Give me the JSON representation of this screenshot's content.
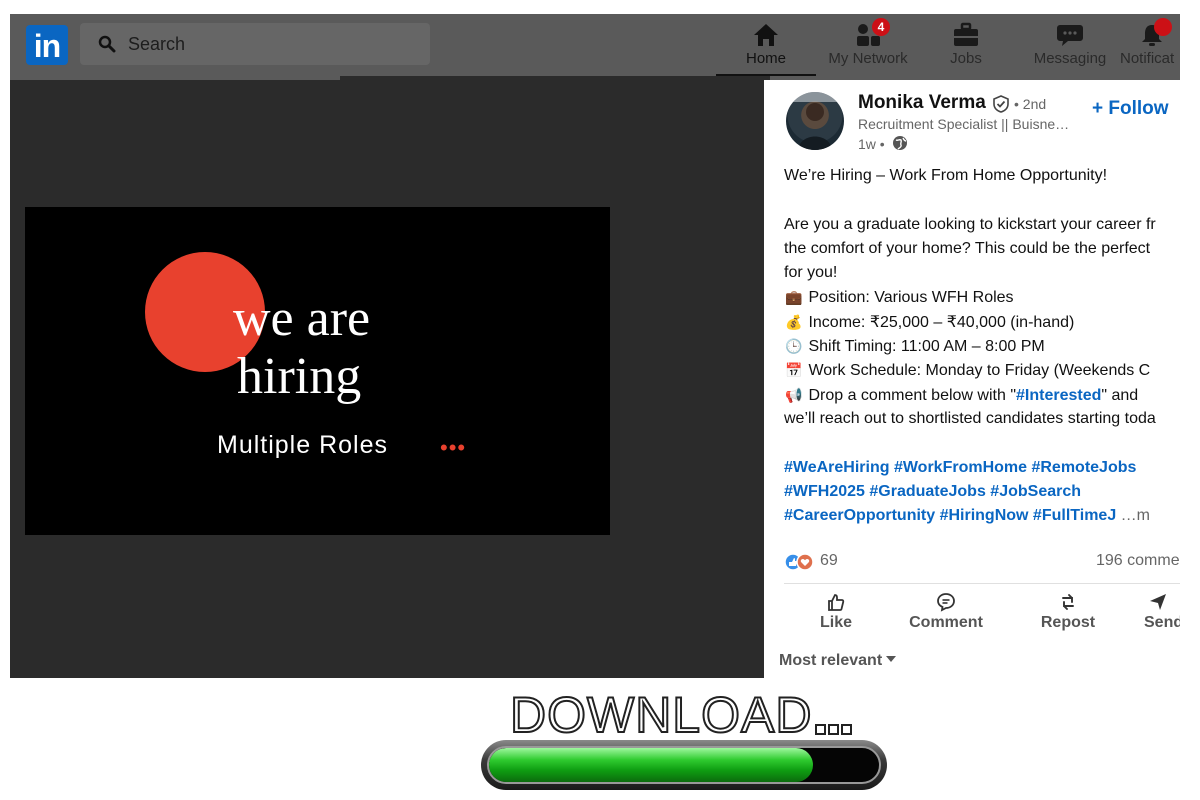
{
  "app": {
    "logo_text": "in",
    "brand_color": "#0a66c2"
  },
  "search": {
    "placeholder": "Search"
  },
  "nav": {
    "items": [
      {
        "label": "Home",
        "icon": "home-icon",
        "active": true
      },
      {
        "label": "My Network",
        "icon": "network-icon",
        "badge": "4"
      },
      {
        "label": "Jobs",
        "icon": "briefcase-icon"
      },
      {
        "label": "Messaging",
        "icon": "messaging-icon"
      },
      {
        "label": "Notificat",
        "icon": "bell-icon",
        "badge": ""
      }
    ]
  },
  "video": {
    "line1": "we are",
    "line2": "hiring",
    "line3": "Multiple Roles",
    "dots": "•••",
    "circle_color": "#e8412e"
  },
  "post": {
    "author": "Monika Verma",
    "degree": "• 2nd",
    "headline": "Recruitment Specialist || Buisne…",
    "time": "1w •",
    "follow": "+ Follow",
    "body": {
      "l1": "We’re Hiring – Work From Home Opportunity!",
      "l2": "Are you a graduate looking to kickstart your career fr",
      "l3": "the comfort of your home? This could be the perfect",
      "l4": "for you!",
      "l5": "Position: Various WFH Roles",
      "l6": "Income: ₹25,000 – ₹40,000 (in-hand)",
      "l7": "Shift Timing: 11:00 AM – 8:00 PM",
      "l8": "Work Schedule: Monday to Friday (Weekends C",
      "l9a": "Drop a comment below with \"",
      "l9tag": "#Interested",
      "l9b": "\" and",
      "l10": "we’ll reach out to shortlisted candidates starting toda"
    },
    "emoji": {
      "position": "💼",
      "income": "💰",
      "shift": "🕒",
      "schedule": "📅",
      "drop": "📢"
    },
    "hashtags": {
      "h1": "#WeAreHiring #WorkFromHome #RemoteJobs",
      "h2": "#WFH2025 #GraduateJobs #JobSearch",
      "h3": "#CareerOpportunity #HiringNow #FullTimeJ",
      "more": "…m"
    },
    "reactions_count": "69",
    "comments_count": "196 comme",
    "actions": {
      "like": "Like",
      "comment": "Comment",
      "repost": "Repost",
      "send": "Send"
    },
    "sort": "Most relevant"
  },
  "download": {
    "text": "DOWNLOAD",
    "progress": 0.83
  }
}
